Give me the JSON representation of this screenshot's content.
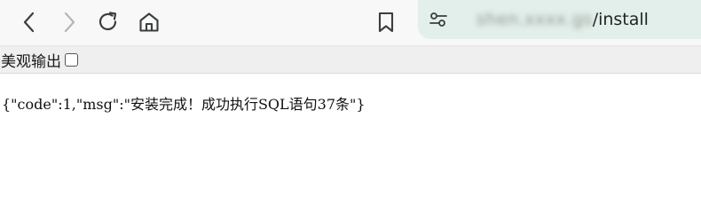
{
  "toolbar": {
    "back_icon": "chevron-left-icon",
    "forward_icon": "chevron-right-icon",
    "reload_icon": "reload-icon",
    "home_icon": "home-icon",
    "bookmark_icon": "bookmark-icon"
  },
  "address": {
    "host": "shen.xxxx.gs",
    "path": "/install",
    "settings_icon": "site-settings-icon"
  },
  "pretty_print": {
    "label": "美观输出",
    "checked": false
  },
  "response": {
    "body": "{\"code\":1,\"msg\":\"安装完成！成功执行SQL语句37条\"}"
  },
  "colors": {
    "address_bg": "#e3efea",
    "toolbar_bg": "#f7f8f7",
    "pretty_bar_bg": "#efefef"
  }
}
